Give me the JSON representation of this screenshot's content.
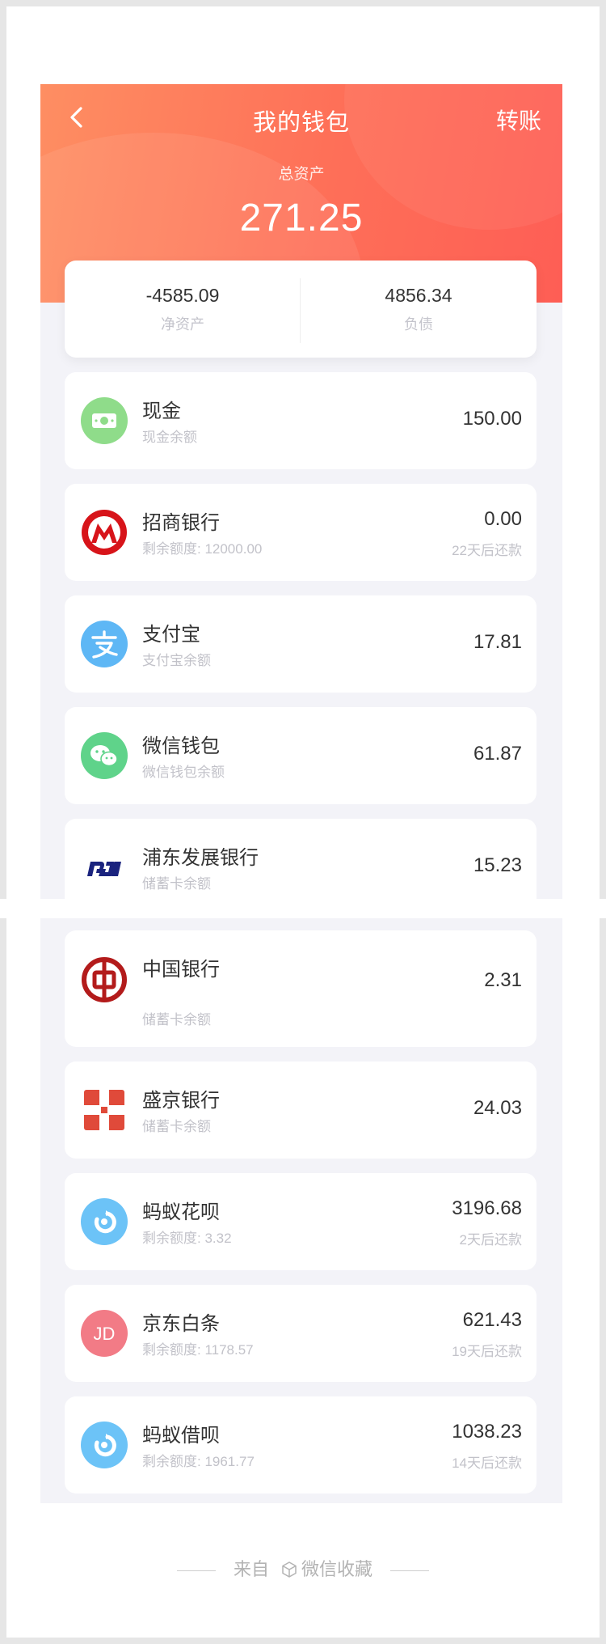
{
  "header": {
    "title": "我的钱包",
    "transfer_label": "转账",
    "total_label": "总资产",
    "total_value": "271.25"
  },
  "summary": {
    "net_value": "-4585.09",
    "net_label": "净资产",
    "debt_value": "4856.34",
    "debt_label": "负债"
  },
  "accounts": [
    {
      "name": "现金",
      "sub": "现金余额",
      "amount": "150.00",
      "icon": "cash-icon"
    },
    {
      "name": "招商银行",
      "sub": "剩余额度: 12000.00",
      "amount": "0.00",
      "due": "22天后还款",
      "icon": "cmb-bank-icon"
    },
    {
      "name": "支付宝",
      "sub": "支付宝余额",
      "amount": "17.81",
      "icon": "alipay-icon"
    },
    {
      "name": "微信钱包",
      "sub": "微信钱包余额",
      "amount": "61.87",
      "icon": "wechat-icon"
    },
    {
      "name": "浦东发展银行",
      "sub": "储蓄卡余额",
      "amount": "15.23",
      "icon": "spdb-bank-icon"
    },
    {
      "name": "中国银行",
      "sub": "储蓄卡余额",
      "amount": "2.31",
      "icon": "boc-bank-icon"
    },
    {
      "name": "盛京银行",
      "sub": "储蓄卡余额",
      "amount": "24.03",
      "icon": "shengjing-bank-icon"
    },
    {
      "name": "蚂蚁花呗",
      "sub": "剩余额度: 3.32",
      "amount": "3196.68",
      "due": "2天后还款",
      "icon": "huabei-icon"
    },
    {
      "name": "京东白条",
      "sub": "剩余额度: 1178.57",
      "amount": "621.43",
      "due": "19天后还款",
      "icon": "jd-baitiao-icon"
    },
    {
      "name": "蚂蚁借呗",
      "sub": "剩余额度: 1961.77",
      "amount": "1038.23",
      "due": "14天后还款",
      "icon": "jiebei-icon"
    }
  ],
  "icon_text": {
    "jd": "JD"
  },
  "footer": {
    "from": "来自",
    "source": "微信收藏"
  },
  "colors": {
    "header_start": "#fe8e62",
    "header_end": "#fe5e55",
    "cash_green": "#8fdc8a",
    "cmb_red": "#d7141a",
    "alipay_blue": "#5eb7f5",
    "wechat_green": "#5fd38a",
    "spdb_navy": "#1a237e",
    "boc_red": "#b31b1b",
    "shengjing_red": "#e04a3a",
    "huabei_blue": "#6cc3f7",
    "jd_pink": "#f27b86"
  }
}
